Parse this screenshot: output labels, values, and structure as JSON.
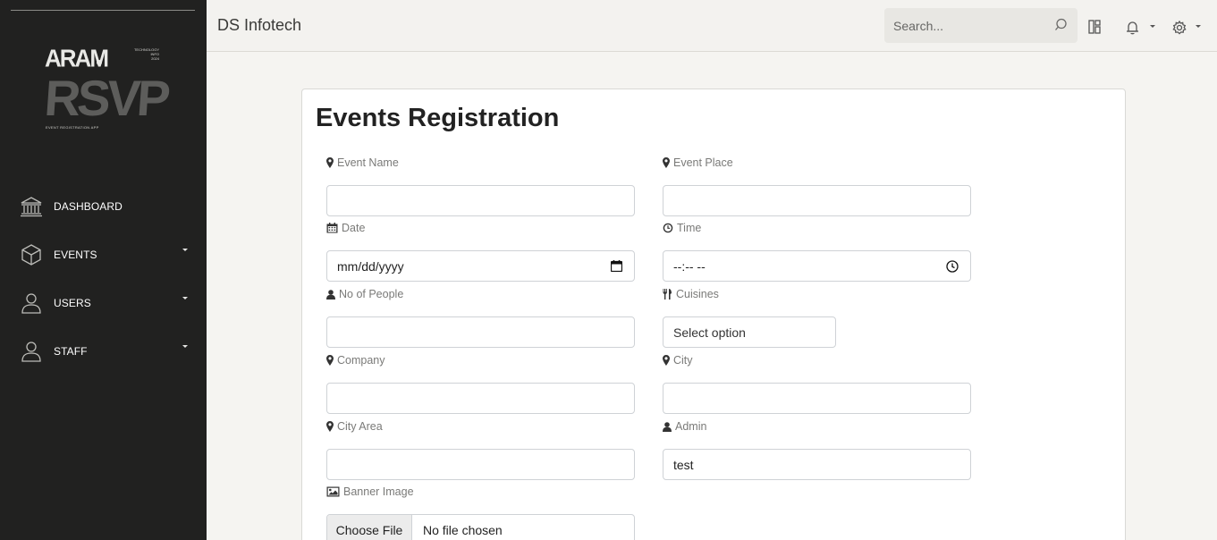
{
  "sidebar": {
    "logo": {
      "top_text": "ARAM",
      "tagline": [
        "TECHNOLOGY",
        "INFO",
        "2024"
      ],
      "main_text": "RSVP",
      "subtitle": "EVENT REGISTRATION APP"
    },
    "items": [
      {
        "label": "DASHBOARD",
        "icon": "bank-icon",
        "has_caret": false
      },
      {
        "label": "EVENTS",
        "icon": "cube-icon",
        "has_caret": true
      },
      {
        "label": "USERS",
        "icon": "user-icon",
        "has_caret": true
      },
      {
        "label": "STAFF",
        "icon": "user-icon",
        "has_caret": true
      }
    ]
  },
  "header": {
    "brand": "DS Infotech",
    "search_placeholder": "Search..."
  },
  "form": {
    "title": "Events Registration",
    "fields": {
      "event_name": {
        "label": "Event Name",
        "icon": "map-marker-icon",
        "value": ""
      },
      "event_place": {
        "label": "Event Place",
        "icon": "map-marker-icon",
        "value": ""
      },
      "date": {
        "label": "Date",
        "icon": "calendar-icon",
        "placeholder": "mm/dd/yyyy"
      },
      "time": {
        "label": "Time",
        "icon": "clock-icon",
        "placeholder": "--:-- --"
      },
      "no_of_people": {
        "label": "No of People",
        "icon": "user-icon",
        "value": ""
      },
      "cuisines": {
        "label": "Cuisines",
        "icon": "cutlery-icon",
        "selected": "Select option"
      },
      "company": {
        "label": "Company",
        "icon": "map-marker-icon",
        "value": ""
      },
      "city": {
        "label": "City",
        "icon": "map-marker-icon",
        "value": ""
      },
      "city_area": {
        "label": "City Area",
        "icon": "map-marker-icon",
        "value": ""
      },
      "admin": {
        "label": "Admin",
        "icon": "user-icon",
        "value": "test"
      },
      "banner_image": {
        "label": "Banner Image",
        "icon": "image-icon",
        "button": "Choose File",
        "status": "No file chosen"
      }
    }
  },
  "colors": {
    "sidebar_bg": "#212120",
    "page_bg": "#f5f4f1",
    "card_bg": "#ffffff",
    "label_color": "#7a7a78"
  }
}
